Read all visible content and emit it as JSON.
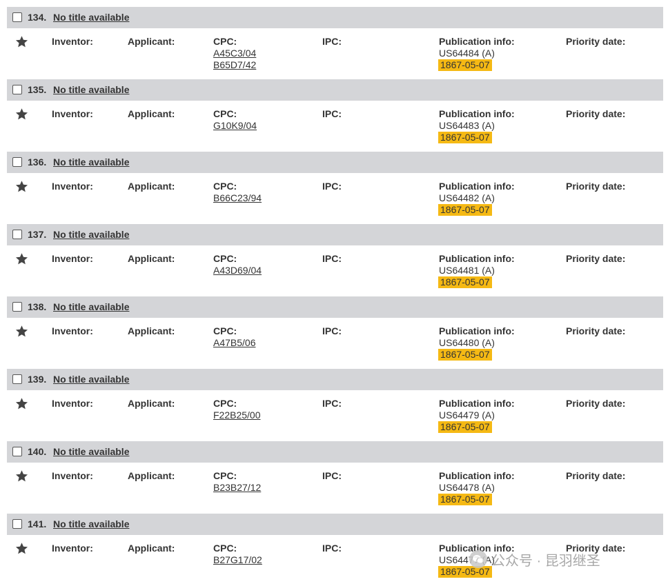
{
  "labels": {
    "inventor": "Inventor:",
    "applicant": "Applicant:",
    "cpc": "CPC:",
    "ipc": "IPC:",
    "publication": "Publication info:",
    "priority": "Priority date:"
  },
  "colors": {
    "header_bg": "#d4d5d8",
    "date_highlight": "#f5b914",
    "text": "#333333"
  },
  "records": [
    {
      "number": "134.",
      "title": "No title available",
      "cpc": [
        "A45C3/04",
        "B65D7/42"
      ],
      "publication": "US64484 (A)",
      "date": "1867-05-07"
    },
    {
      "number": "135.",
      "title": "No title available",
      "cpc": [
        "G10K9/04"
      ],
      "publication": "US64483 (A)",
      "date": "1867-05-07"
    },
    {
      "number": "136.",
      "title": "No title available",
      "cpc": [
        "B66C23/94"
      ],
      "publication": "US64482 (A)",
      "date": "1867-05-07"
    },
    {
      "number": "137.",
      "title": "No title available",
      "cpc": [
        "A43D69/04"
      ],
      "publication": "US64481 (A)",
      "date": "1867-05-07"
    },
    {
      "number": "138.",
      "title": "No title available",
      "cpc": [
        "A47B5/06"
      ],
      "publication": "US64480 (A)",
      "date": "1867-05-07"
    },
    {
      "number": "139.",
      "title": "No title available",
      "cpc": [
        "F22B25/00"
      ],
      "publication": "US64479 (A)",
      "date": "1867-05-07"
    },
    {
      "number": "140.",
      "title": "No title available",
      "cpc": [
        "B23B27/12"
      ],
      "publication": "US64478 (A)",
      "date": "1867-05-07"
    },
    {
      "number": "141.",
      "title": "No title available",
      "cpc": [
        "B27G17/02"
      ],
      "publication": "US64477 (A)",
      "date": "1867-05-07"
    }
  ],
  "watermark": {
    "text": "公众号 · 昆羽继圣",
    "icon": "wechat-icon"
  }
}
